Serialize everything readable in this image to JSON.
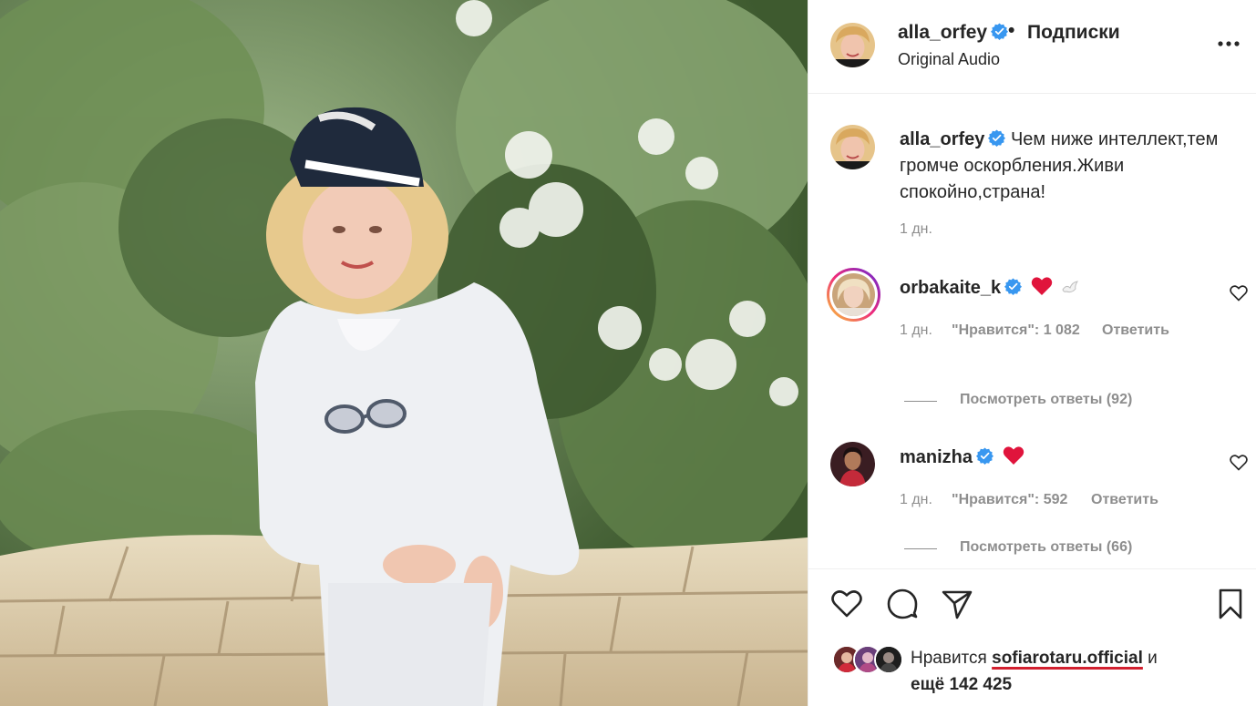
{
  "header": {
    "username": "alla_orfey",
    "separator": "•",
    "follow_label": "Подписки",
    "audio_label": "Original Audio"
  },
  "caption": {
    "username": "alla_orfey",
    "text": "Чем ниже интеллект,тем громче оскорбления.Живи спокойно,страна!",
    "time": "1 дн."
  },
  "comments": [
    {
      "username": "orbakaite_k",
      "time": "1 дн.",
      "likes_label": "\"Нравится\": 1 082",
      "reply_label": "Ответить",
      "view_replies": "Посмотреть ответы (92)",
      "emojis": [
        "red-heart",
        "dove"
      ]
    },
    {
      "username": "manizha",
      "time": "1 дн.",
      "likes_label": "\"Нравится\": 592",
      "reply_label": "Ответить",
      "view_replies": "Посмотреть ответы (66)",
      "emojis": [
        "red-heart"
      ]
    }
  ],
  "likes": {
    "prefix": "Нравится",
    "liker": "sofiarotaru.official",
    "conjunction": "и",
    "others": "ещё 142 425"
  },
  "icons": {
    "verified": "verified-badge-icon",
    "more": "more-options-icon",
    "like": "heart-icon",
    "comment": "comment-icon",
    "share": "share-icon",
    "save": "bookmark-icon"
  },
  "colors": {
    "verified": "#3897f0",
    "heart": "#e0143c",
    "secondary_text": "#8e8e8e",
    "highlight_underline": "#d2202f"
  }
}
